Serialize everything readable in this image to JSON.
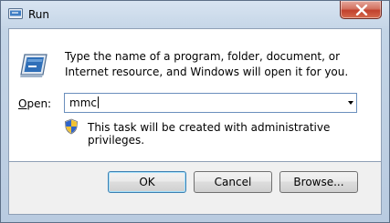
{
  "window": {
    "title": "Run",
    "close_icon": "close-icon",
    "run_icon": "run-icon"
  },
  "dialog": {
    "description": "Type the name of a program, folder, document, or Internet resource, and Windows will open it for you.",
    "open_label_prefix": "",
    "open_label_accel": "O",
    "open_label_rest": "pen:",
    "open_value": "mmc",
    "admin_icon": "uac-shield-icon",
    "admin_note": "This task will be created with administrative privileges."
  },
  "buttons": {
    "ok": "OK",
    "cancel": "Cancel",
    "browse": "Browse..."
  }
}
